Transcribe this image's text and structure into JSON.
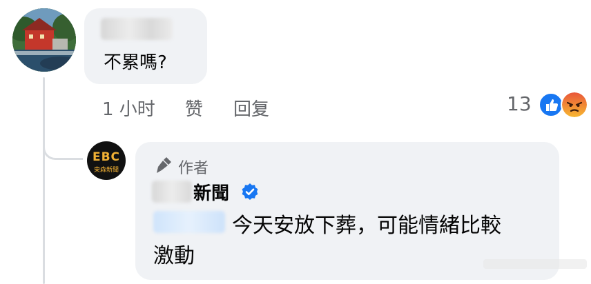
{
  "comment": {
    "text": "不累嗎?",
    "time": "1 小时",
    "like_label": "赞",
    "reply_label": "回复",
    "reaction_count": "13",
    "reactions": [
      "like-icon",
      "angry-icon"
    ]
  },
  "reply": {
    "author_badge": "作者",
    "page_name": "新聞",
    "text_line1": "今天安放下葬，可能情緒比較",
    "text_line2": "激動",
    "avatar_logo": "EBC",
    "avatar_sub": "東森新聞"
  },
  "colors": {
    "bubble_bg": "#f0f2f5",
    "meta_text": "#65676b",
    "like_blue": "#1877f2",
    "verified_blue": "#1877f2",
    "thread_line": "#dadde1"
  }
}
